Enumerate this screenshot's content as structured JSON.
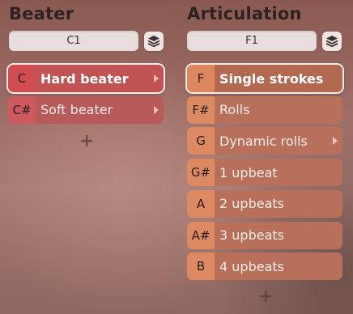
{
  "beater": {
    "title": "Beater",
    "selector_value": "C1",
    "items": [
      {
        "key": "C",
        "label": "Hard beater",
        "selected": true,
        "has_arrow": true
      },
      {
        "key": "C#",
        "label": "Soft beater",
        "selected": false,
        "has_arrow": true
      }
    ],
    "add_icon": "plus-icon",
    "layers_icon": "layers-icon",
    "accent_color": "#cf5a5d"
  },
  "articulation": {
    "title": "Articulation",
    "selector_value": "F1",
    "items": [
      {
        "key": "F",
        "label": "Single strokes",
        "selected": true,
        "has_arrow": false
      },
      {
        "key": "F#",
        "label": "Rolls",
        "selected": false,
        "has_arrow": false
      },
      {
        "key": "G",
        "label": "Dynamic rolls",
        "selected": false,
        "has_arrow": true
      },
      {
        "key": "G#",
        "label": "1 upbeat",
        "selected": false,
        "has_arrow": false
      },
      {
        "key": "A",
        "label": "2 upbeats",
        "selected": false,
        "has_arrow": false
      },
      {
        "key": "A#",
        "label": "3 upbeats",
        "selected": false,
        "has_arrow": false
      },
      {
        "key": "B",
        "label": "4 upbeats",
        "selected": false,
        "has_arrow": false
      }
    ],
    "add_icon": "plus-icon",
    "layers_icon": "layers-icon",
    "accent_color": "#dd8a63"
  }
}
